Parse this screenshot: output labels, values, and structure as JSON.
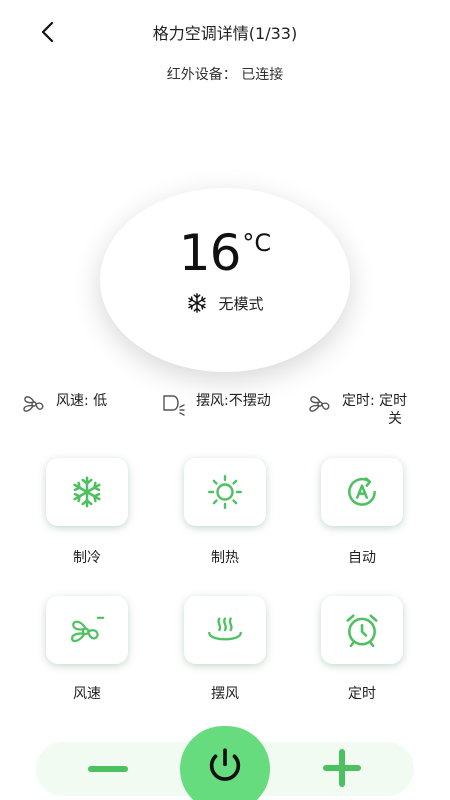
{
  "header": {
    "title": "格力空调详情(1/33)",
    "subtitle": "红外设备：  已连接",
    "back_icon": "chevron-left-icon"
  },
  "display": {
    "temperature": "16",
    "unit": "°C",
    "mode_icon": "snowflake-icon",
    "mode_text": "无模式"
  },
  "status": {
    "fan_speed": "风速:  低",
    "swing": "摆风:不摆动",
    "timer_line1": "定时:  定时",
    "timer_line2": "关"
  },
  "buttons": [
    {
      "label": "制冷",
      "icon": "snowflake-icon"
    },
    {
      "label": "制热",
      "icon": "sun-icon"
    },
    {
      "label": "自动",
      "icon": "auto-icon"
    },
    {
      "label": "风速",
      "icon": "fan-icon"
    },
    {
      "label": "摆风",
      "icon": "swing-icon"
    },
    {
      "label": "定时",
      "icon": "alarm-clock-icon"
    }
  ],
  "controls": {
    "minus_icon": "minus-icon",
    "power_icon": "power-icon",
    "plus_icon": "plus-icon"
  },
  "colors": {
    "accent": "#4cc15f",
    "power": "#66dc7e",
    "bar": "#f2fbf1"
  }
}
